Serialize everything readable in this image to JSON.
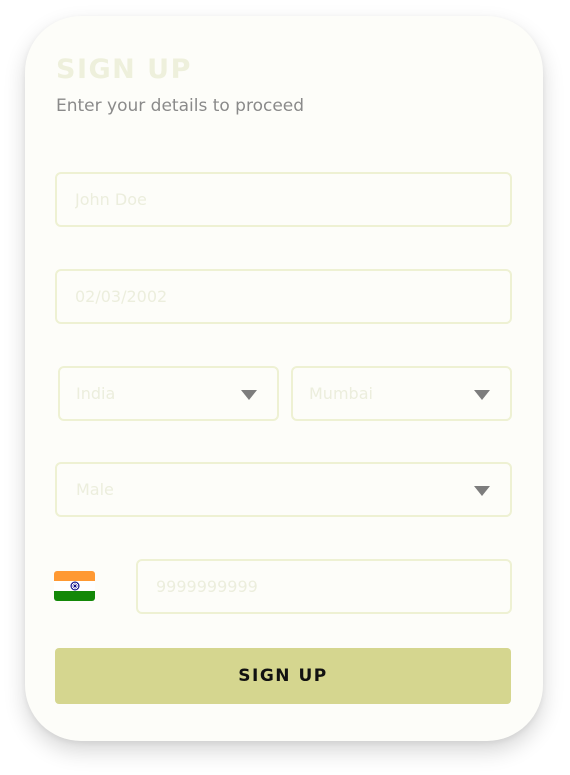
{
  "header": {
    "title": "SIGN UP",
    "subtitle": "Enter your details to proceed"
  },
  "form": {
    "name_placeholder": "John Doe",
    "dob_placeholder": "02/03/2002",
    "country_value": "India",
    "city_value": "Mumbai",
    "gender_value": "Male",
    "phone_placeholder": "9999999999",
    "submit_label": "SIGN UP"
  },
  "colors": {
    "button_bg": "#d5d68f",
    "field_border": "#eef1d3",
    "card_bg": "#fdfdf9"
  },
  "icons": {
    "country_flag": "india-flag-icon",
    "dropdown": "caret-down-icon"
  }
}
